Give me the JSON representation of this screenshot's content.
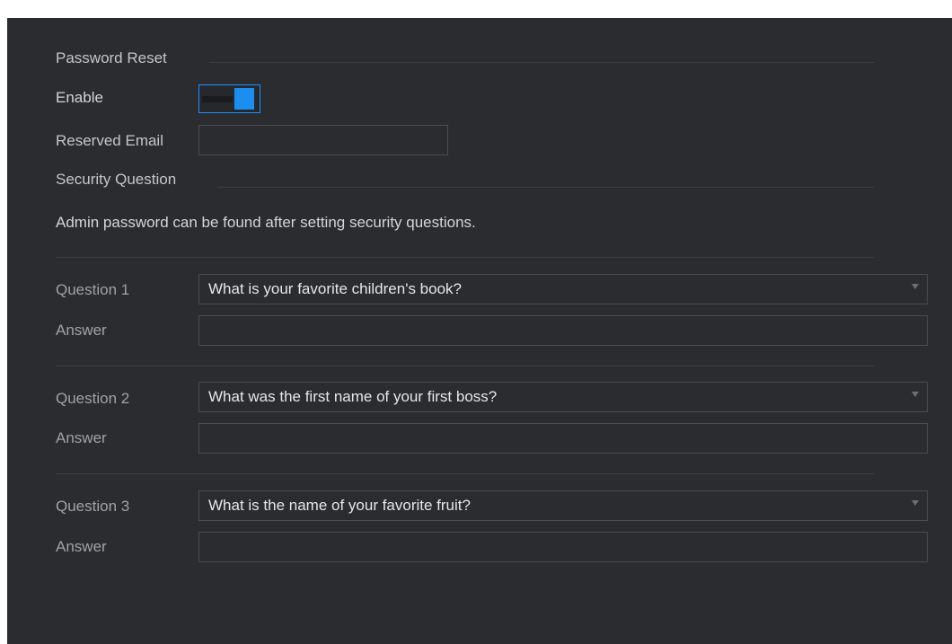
{
  "password_reset": {
    "section_title": "Password Reset",
    "enable_label": "Enable",
    "enabled": true,
    "reserved_email_label": "Reserved Email",
    "reserved_email_value": ""
  },
  "security_question": {
    "section_title": "Security Question",
    "hint": "Admin password can be found after setting security questions.",
    "questions": [
      {
        "label": "Question 1",
        "selected": "What is your favorite children's book?",
        "answer_label": "Answer",
        "answer_value": ""
      },
      {
        "label": "Question 2",
        "selected": "What was the first name of your first boss?",
        "answer_label": "Answer",
        "answer_value": ""
      },
      {
        "label": "Question 3",
        "selected": "What is the name of your favorite fruit?",
        "answer_label": "Answer",
        "answer_value": ""
      }
    ]
  },
  "colors": {
    "background": "#2b2c2f",
    "accent": "#1b8ff0",
    "text": "#c3c6cc",
    "border": "#4a4c52"
  },
  "icons": {
    "dropdown": "chevron-down-icon"
  }
}
